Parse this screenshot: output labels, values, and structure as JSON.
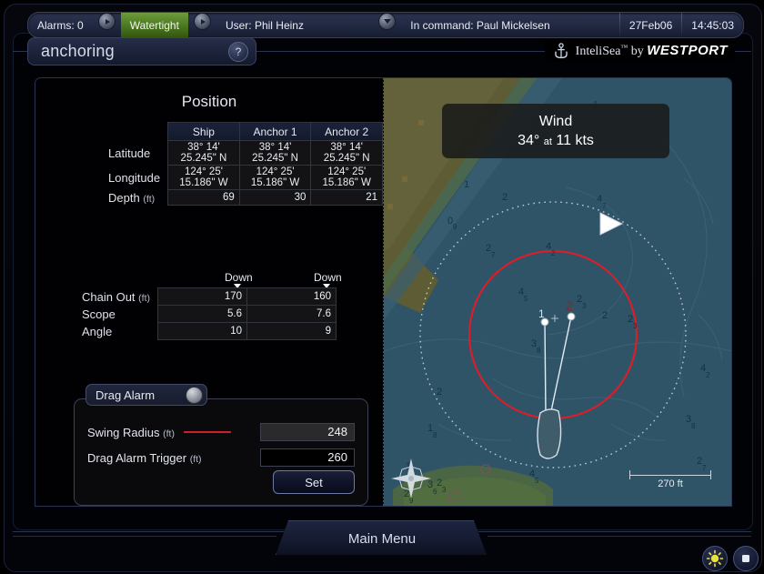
{
  "statusbar": {
    "alarms": "Alarms: 0",
    "mode": "Watertight",
    "user": "User:  Phil Heinz",
    "command": "In command:  Paul Mickelsen",
    "date": "27Feb06",
    "time": "14:45:03",
    "arrow_icon": "chevron-right-icon",
    "dropdown_icon": "chevron-down-icon"
  },
  "header": {
    "page_title": "anchoring",
    "help_label": "?",
    "brand_name": "InteliSea",
    "brand_tm": "™",
    "brand_by": " by ",
    "brand_company": "WESTPORT",
    "brand_icon": "anchor-icon"
  },
  "position": {
    "title": "Position",
    "columns": [
      "Ship",
      "Anchor 1",
      "Anchor 2"
    ],
    "rows": [
      {
        "label": "Latitude",
        "unit": "",
        "values": [
          "38° 14' 25.245\" N",
          "38° 14' 25.245\" N",
          "38° 14' 25.245\" N"
        ],
        "align": "center"
      },
      {
        "label": "Longitude",
        "unit": "",
        "values": [
          "124° 25' 15.186\" W",
          "124° 25' 15.186\" W",
          "124° 25' 15.186\" W"
        ],
        "align": "center"
      },
      {
        "label": "Depth",
        "unit": "(ft)",
        "values": [
          "69",
          "30",
          "21"
        ],
        "align": "right"
      }
    ]
  },
  "chain": {
    "down_labels": [
      "Down",
      "Down"
    ],
    "rows": [
      {
        "label": "Chain Out",
        "unit": "(ft)",
        "values": [
          "170",
          "160"
        ]
      },
      {
        "label": "Scope",
        "unit": "",
        "values": [
          "5.6",
          "7.6"
        ]
      },
      {
        "label": "Angle",
        "unit": "",
        "values": [
          "10",
          "9"
        ]
      }
    ]
  },
  "drag_alarm": {
    "group_label": "Drag Alarm",
    "knob_icon": "toggle-knob-icon",
    "swing_radius_label": "Swing Radius",
    "swing_radius_unit": "(ft)",
    "swing_radius_value": "248",
    "trigger_label": "Drag Alarm Trigger",
    "trigger_unit": "(ft)",
    "trigger_value": "260",
    "set_label": "Set",
    "legend_color": "#cf1f2a"
  },
  "chart_data": {
    "type": "map",
    "title": "Wind",
    "wind_heading": "34°",
    "wind_at": "at",
    "wind_speed": "11 kts",
    "scale_label": "270 ft",
    "scale_ft": 270,
    "swing_radius_ft": 248,
    "drag_trigger_ft": 260,
    "anchor_markers": [
      "1",
      "2"
    ],
    "depth_soundings": [
      "1",
      "2",
      "0 9",
      "1",
      "2 7",
      "4 2",
      "4 7",
      "4 5",
      "2 3",
      "2",
      "1 8",
      "3 8",
      "1 4",
      "3 6",
      "2 9",
      "2 7",
      "4 2",
      "3 8",
      "2 3",
      "4 5",
      "5",
      "1"
    ],
    "ship_heading_deg": 200,
    "wind_arrow_deg": 34,
    "colors": {
      "water": "#2f5468",
      "shallow": "#3b6074",
      "land": "#5b5a33",
      "green": "#4a6a44",
      "drag_circle": "#e01c28",
      "swing_circle": "#cfd8e0"
    }
  },
  "footer": {
    "main_menu": "Main Menu",
    "brightness_icon": "sun-brightness-icon",
    "power_icon": "stop-square-icon"
  }
}
